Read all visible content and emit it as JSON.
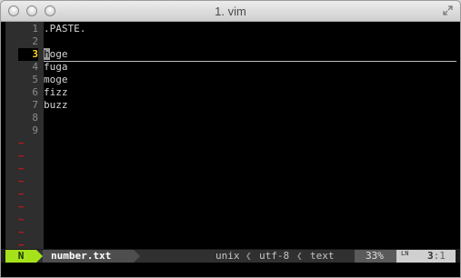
{
  "window": {
    "title": "1. vim"
  },
  "buffer": {
    "lines": [
      {
        "number": "1",
        "text": ".PASTE."
      },
      {
        "number": "2",
        "text": ""
      },
      {
        "number": "3",
        "text": "hoge",
        "cursor_char": "h",
        "rest": "oge",
        "current": true
      },
      {
        "number": "4",
        "text": "fuga"
      },
      {
        "number": "5",
        "text": "moge"
      },
      {
        "number": "6",
        "text": "fizz"
      },
      {
        "number": "7",
        "text": "buzz"
      },
      {
        "number": "8",
        "text": ""
      },
      {
        "number": "9",
        "text": ""
      }
    ],
    "filler": "~",
    "filler_color": "#c81818",
    "current_line_color": "#ffd21a"
  },
  "statusline": {
    "mode": "N",
    "mode_color": "#a6e21a",
    "filename": "number.txt",
    "fileformat": "unix",
    "encoding": "utf-8",
    "filetype": "text",
    "percent": "33%",
    "line_glyph": "LN",
    "line": "3",
    "column": "1",
    "separator_glyph": "❮",
    "position_divider": ":"
  },
  "icons": {
    "close": "traffic-light-close",
    "minimize": "traffic-light-minimize",
    "zoom": "traffic-light-zoom",
    "fullscreen": "fullscreen-arrows-icon"
  }
}
